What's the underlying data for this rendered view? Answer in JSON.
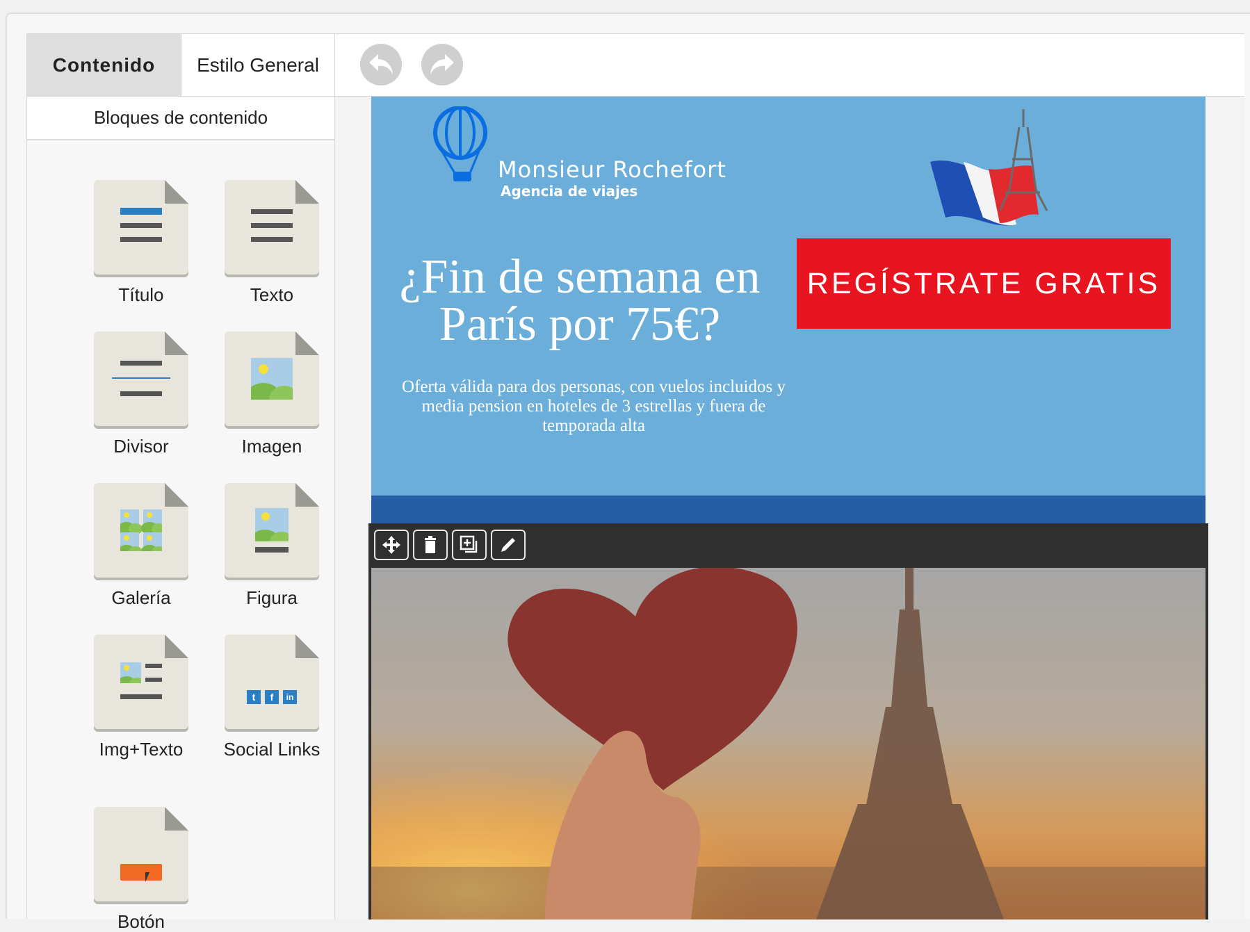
{
  "tabs": {
    "content": "Contenido",
    "general_style": "Estilo General"
  },
  "sidebar": {
    "heading": "Bloques de contenido",
    "blocks": [
      {
        "label": "Título",
        "icon": "title-block-icon"
      },
      {
        "label": "Texto",
        "icon": "text-block-icon"
      },
      {
        "label": "Divisor",
        "icon": "divider-block-icon"
      },
      {
        "label": "Imagen",
        "icon": "image-block-icon"
      },
      {
        "label": "Galería",
        "icon": "gallery-block-icon"
      },
      {
        "label": "Figura",
        "icon": "figure-block-icon"
      },
      {
        "label": "Img+Texto",
        "icon": "image-text-block-icon"
      },
      {
        "label": "Social Links",
        "icon": "social-links-block-icon"
      },
      {
        "label": "Botón",
        "icon": "button-block-icon"
      }
    ]
  },
  "toolbar": {
    "undo_icon": "undo-icon",
    "redo_icon": "redo-icon"
  },
  "email": {
    "logo_name": "Monsieur Rochefort",
    "logo_tagline": "Agencia de viajes",
    "headline": "¿Fin de semana en París por 75€?",
    "offer_text": "Oferta válida para dos personas, con vuelos incluidos y media pension en hoteles de 3 estrellas y fuera de temporada alta",
    "cta_label": "REGÍSTRATE GRATIS"
  },
  "block_toolbar": [
    "move-icon",
    "delete-icon",
    "duplicate-icon",
    "edit-icon"
  ],
  "colors": {
    "hero_bg": "#6aaed9",
    "cta_bg": "#e8141f",
    "strip": "#255ea4",
    "toolbar": "#2f2f2f"
  }
}
